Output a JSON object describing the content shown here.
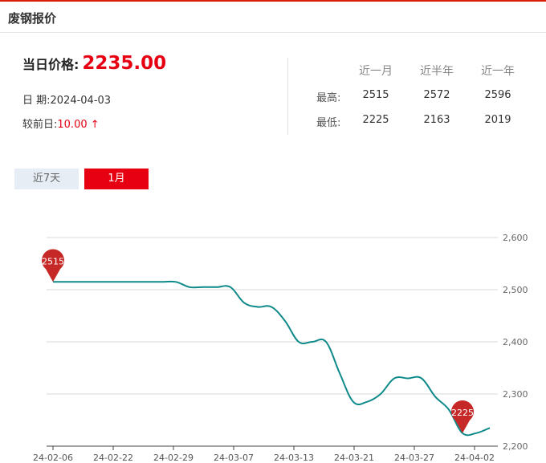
{
  "header": {
    "title": "废钢报价"
  },
  "price": {
    "label": "当日价格:",
    "value": "2235.00"
  },
  "date": {
    "label": "日 期:",
    "value": "2024-04-03"
  },
  "change": {
    "label": "较前日:",
    "value": "10.00",
    "arrow": "↑"
  },
  "stats": {
    "headers": [
      "近一月",
      "近半年",
      "近一年"
    ],
    "rows": [
      {
        "label": "最高:",
        "values": [
          "2515",
          "2572",
          "2596"
        ]
      },
      {
        "label": "最低:",
        "values": [
          "2225",
          "2163",
          "2019"
        ]
      }
    ]
  },
  "tabs": [
    {
      "label": "近7天",
      "active": false
    },
    {
      "label": "1月",
      "active": true
    }
  ],
  "colors": {
    "accent": "#e60012",
    "line": "#0e8a8a",
    "marker": "#c62828"
  },
  "chart_data": {
    "type": "line",
    "title": "",
    "xlabel": "",
    "ylabel": "",
    "ylim": [
      2200,
      2600
    ],
    "yticks": [
      2200,
      2300,
      2400,
      2500,
      2600
    ],
    "ytick_labels": [
      "2,200",
      "2,300",
      "2,400",
      "2,500",
      "2,600"
    ],
    "xtick_labels": [
      "24-02-06",
      "24-02-22",
      "24-02-29",
      "24-03-07",
      "24-03-13",
      "24-03-21",
      "24-03-27",
      "24-04-02"
    ],
    "grid": true,
    "series": [
      {
        "values": [
          2515,
          2515,
          2515,
          2515,
          2515,
          2515,
          2515,
          2515,
          2515,
          2515,
          2505,
          2505,
          2505,
          2505,
          2475,
          2467,
          2467,
          2440,
          2400,
          2400,
          2400,
          2340,
          2285,
          2285,
          2300,
          2330,
          2330,
          2330,
          2295,
          2270,
          2225,
          2225,
          2235
        ]
      }
    ],
    "annotations": [
      {
        "label": "2515",
        "index": 0,
        "value": 2515
      },
      {
        "label": "2225",
        "index": 30,
        "value": 2225
      }
    ]
  }
}
